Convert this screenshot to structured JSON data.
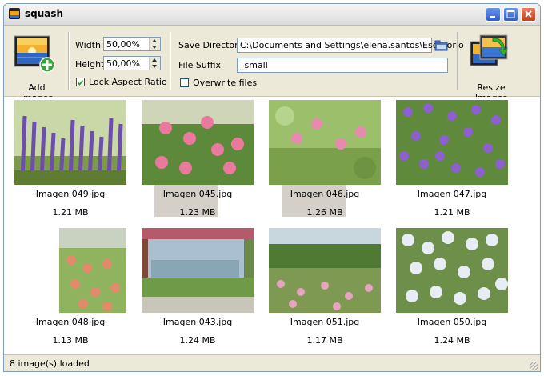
{
  "window": {
    "title": "squash"
  },
  "toolbar": {
    "add_images_label": "Add Images",
    "resize_images_label": "Resize Images",
    "width_label": "Width",
    "width_value": "50,00%",
    "height_label": "Height",
    "height_value": "50,00%",
    "lock_aspect_label": "Lock Aspect Ratio",
    "lock_aspect_checked": true,
    "save_directory_label": "Save Directory",
    "save_directory_value": "C:\\Documents and Settings\\elena.santos\\Escritorio",
    "file_suffix_label": "File Suffix",
    "file_suffix_value": "_small",
    "overwrite_label": "Overwrite files",
    "overwrite_checked": false
  },
  "images": [
    {
      "name": "Imagen 049.jpg",
      "size": "1.21 MB",
      "selected": false,
      "scene": "lavender"
    },
    {
      "name": "Imagen 045.jpg",
      "size": "1.23 MB",
      "selected": true,
      "scene": "pink-roses"
    },
    {
      "name": "Imagen 046.jpg",
      "size": "1.26 MB",
      "selected": true,
      "scene": "pink-bush"
    },
    {
      "name": "Imagen 047.jpg",
      "size": "1.21 MB",
      "selected": false,
      "scene": "purple-flowers"
    },
    {
      "name": "Imagen 048.jpg",
      "size": "1.13 MB",
      "selected": false,
      "scene": "rose-garden"
    },
    {
      "name": "Imagen 043.jpg",
      "size": "1.24 MB",
      "selected": false,
      "scene": "pergola"
    },
    {
      "name": "Imagen 051.jpg",
      "size": "1.17 MB",
      "selected": false,
      "scene": "park"
    },
    {
      "name": "Imagen 050.jpg",
      "size": "1.24 MB",
      "selected": false,
      "scene": "white-flowers"
    }
  ],
  "status": {
    "text": "8 image(s) loaded"
  },
  "icons": {
    "add_images": "add-images-icon",
    "resize_images": "resize-images-icon",
    "browse_folder": "folder-icon",
    "app": "app-icon",
    "minimize": "minimize-icon",
    "maximize": "maximize-icon",
    "close": "close-icon"
  },
  "colors": {
    "selection": "#d4d0c8",
    "window_bg": "#ece9d8",
    "close_button": "#c7401e",
    "caption_button": "#2c5fd0"
  }
}
